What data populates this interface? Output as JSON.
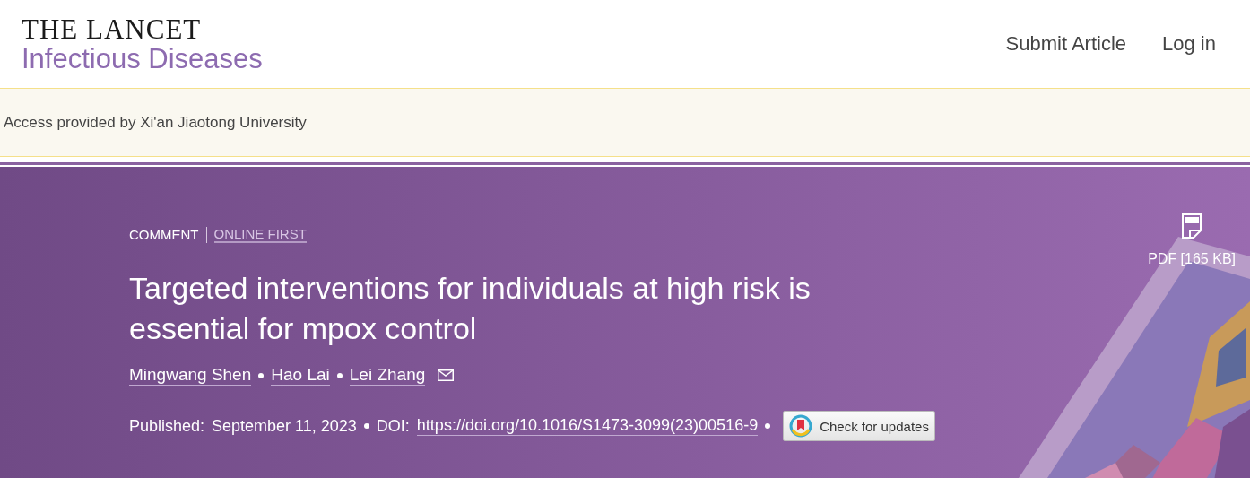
{
  "header": {
    "journal": "THE LANCET",
    "subtitle": "Infectious Diseases",
    "nav": [
      "Submit Article",
      "Log in"
    ]
  },
  "access_banner": {
    "text": "Access provided by Xi'an Jiaotong University"
  },
  "article": {
    "type": "COMMENT",
    "status": "ONLINE FIRST",
    "title": "Targeted interventions for individuals at high risk is essential for mpox control",
    "authors": [
      {
        "name": "Mingwang Shen",
        "corresponding": false
      },
      {
        "name": "Hao Lai",
        "corresponding": false
      },
      {
        "name": "Lei Zhang",
        "corresponding": true
      }
    ],
    "published_label": "Published:",
    "published_date": "September 11, 2023",
    "doi_label": "DOI:",
    "doi": "https://doi.org/10.1016/S1473-3099(23)00516-9",
    "updates_button": "Check for updates",
    "pdf": "PDF [165 KB]"
  }
}
